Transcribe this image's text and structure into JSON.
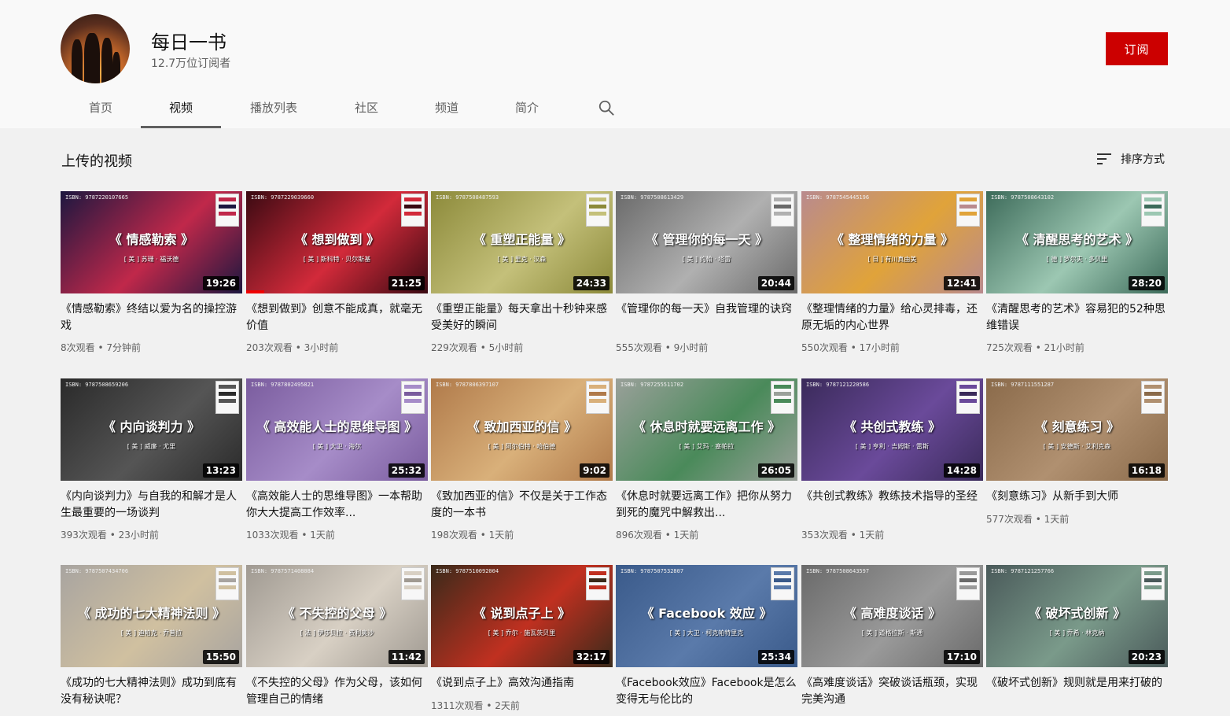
{
  "channel": {
    "name": "每日一书",
    "subscribers": "12.7万位订阅者",
    "subscribe_label": "订阅"
  },
  "tabs": [
    {
      "label": "首页",
      "active": false
    },
    {
      "label": "视频",
      "active": true
    },
    {
      "label": "播放列表",
      "active": false
    },
    {
      "label": "社区",
      "active": false
    },
    {
      "label": "频道",
      "active": false
    },
    {
      "label": "简介",
      "active": false
    }
  ],
  "search_icon": "search-icon",
  "section": {
    "title": "上传的视频",
    "sort_label": "排序方式",
    "sort_icon": "sort-icon"
  },
  "videos": [
    {
      "title": "《情感勒索》终结以爱为名的操控游戏",
      "views": "8次观看",
      "age": "7分钟前",
      "duration": "19:26",
      "thumb_title": "《 情感勒索 》",
      "thumb_author": "[ 美 ] 苏珊 · 福沃德",
      "isbn": "ISBN: 9787220107665",
      "bg": "#1c1740",
      "accent": "#c0284a"
    },
    {
      "title": "《想到做到》创意不能成真，就毫无价值",
      "views": "203次观看",
      "age": "3小时前",
      "duration": "21:25",
      "thumb_title": "《 想到做到 》",
      "thumb_author": "[ 美 ] 斯科特 · 贝尔斯基",
      "isbn": "ISBN: 9787229039660",
      "bg": "#3a0a12",
      "accent": "#d22a3a"
    },
    {
      "title": "《重塑正能量》每天拿出十秒钟来感受美好的瞬间",
      "views": "229次观看",
      "age": "5小时前",
      "duration": "24:33",
      "thumb_title": "《 重塑正能量 》",
      "thumb_author": "[ 美 ] 里克 · 汉森",
      "isbn": "ISBN: 9787508487593",
      "bg": "#8c8a3a",
      "accent": "#c4c07a"
    },
    {
      "title": "《管理你的每一天》自我管理的诀窍",
      "views": "555次观看",
      "age": "9小时前",
      "duration": "20:44",
      "thumb_title": "《 管理你的每一天 》",
      "thumb_author": "[ 美 ] 约翰 · 塔雷",
      "isbn": "ISBN: 9787508613429",
      "bg": "#6a6a6a",
      "accent": "#b0b0b0"
    },
    {
      "title": "《整理情绪的力量》给心灵排毒，还原无垢的内心世界",
      "views": "550次观看",
      "age": "17小时前",
      "duration": "12:41",
      "thumb_title": "《 整理情绪的力量 》",
      "thumb_author": "[ 日 ] 有川真由美",
      "isbn": "ISBN: 9787545445196",
      "bg": "#b98a8e",
      "accent": "#e0a33a"
    },
    {
      "title": "《清醒思考的艺术》容易犯的52种思维错误",
      "views": "725次观看",
      "age": "21小时前",
      "duration": "28:20",
      "thumb_title": "《 清醒思考的艺术 》",
      "thumb_author": "[ 德 ] 罗尔夫 · 多贝里",
      "isbn": "ISBN: 9787508643102",
      "bg": "#3d6b5a",
      "accent": "#9cc7b2"
    },
    {
      "title": "《内向谈判力》与自我的和解才是人生最重要的一场谈判",
      "views": "393次观看",
      "age": "23小时前",
      "duration": "13:23",
      "thumb_title": "《 内向谈判力 》",
      "thumb_author": "[ 美 ] 威廉 · 尤里",
      "isbn": "ISBN: 9787508659206",
      "bg": "#2a2a2a",
      "accent": "#555555"
    },
    {
      "title": "《高效能人士的思维导图》一本帮助你大大提高工作效率...",
      "views": "1033次观看",
      "age": "1天前",
      "duration": "25:32",
      "thumb_title": "《 高效能人士的思维导图 》",
      "thumb_author": "[ 美 ] 大卫 · 海尔",
      "isbn": "ISBN: 9787802495821",
      "bg": "#7a5c9e",
      "accent": "#a68cc8"
    },
    {
      "title": "《致加西亚的信》不仅是关于工作态度的一本书",
      "views": "198次观看",
      "age": "1天前",
      "duration": "9:02",
      "thumb_title": "《 致加西亚的信 》",
      "thumb_author": "[ 美 ] 阿尔伯特 · 哈伯德",
      "isbn": "ISBN: 9787806397107",
      "bg": "#b07a4a",
      "accent": "#d9b07a"
    },
    {
      "title": "《休息时就要远离工作》把你从努力到死的魔咒中解救出...",
      "views": "896次观看",
      "age": "1天前",
      "duration": "26:05",
      "thumb_title": "《 休息时就要远离工作 》",
      "thumb_author": "[ 美 ] 艾玛 · 塞帕拉",
      "isbn": "ISBN: 9787255511702",
      "bg": "#9aa09a",
      "accent": "#4a8a5a"
    },
    {
      "title": "《共创式教练》教练技术指导的圣经",
      "views": "353次观看",
      "age": "1天前",
      "duration": "14:28",
      "thumb_title": "《 共创式教练 》",
      "thumb_author": "[ 美 ] 亨利 · 吉姆斯 · 雷斯",
      "isbn": "ISBN: 9787121220586",
      "bg": "#3a2a5a",
      "accent": "#6a4a9a"
    },
    {
      "title": "《刻意练习》从新手到大师",
      "views": "577次观看",
      "age": "1天前",
      "duration": "16:18",
      "thumb_title": "《 刻意练习 》",
      "thumb_author": "[ 美 ] 安德斯 · 艾利克森",
      "isbn": "ISBN: 9787111551287",
      "bg": "#8a6a4a",
      "accent": "#b09070"
    },
    {
      "title": "《成功的七大精神法则》成功到底有没有秘诀呢？",
      "views": "",
      "age": "",
      "duration": "15:50",
      "thumb_title": "《 成功的七大精神法则 》",
      "thumb_author": "[ 美 ] 迪帕克 · 乔普拉",
      "isbn": "ISBN: 9787507434706",
      "bg": "#a8a4a0",
      "accent": "#d0c0a0"
    },
    {
      "title": "《不失控的父母》作为父母，该如何管理自己的情绪",
      "views": "",
      "age": "",
      "duration": "11:42",
      "thumb_title": "《 不失控的父母 》",
      "thumb_author": "[ 法 ] 伊莎贝拉 · 费利奥沙",
      "isbn": "ISBN: 9787571408084",
      "bg": "#a09a92",
      "accent": "#d8d0c4"
    },
    {
      "title": "《说到点子上》高效沟通指南",
      "views": "1311次观看",
      "age": "2天前",
      "duration": "32:17",
      "thumb_title": "《 说到点子上 》",
      "thumb_author": "[ 美 ] 乔尔 · 施瓦茨贝里",
      "isbn": "ISBN: 9787510092004",
      "bg": "#3a2a1a",
      "accent": "#c03020"
    },
    {
      "title": "《Facebook效应》Facebook是怎么变得无与伦比的",
      "views": "",
      "age": "",
      "duration": "25:34",
      "thumb_title": "《 Facebook 效应 》",
      "thumb_author": "[ 美 ] 大卫 · 柯克帕特里克",
      "isbn": "ISBN: 9787507532807",
      "bg": "#3a5a8a",
      "accent": "#5a7aaa"
    },
    {
      "title": "《高难度谈话》突破谈话瓶颈，实现完美沟通",
      "views": "",
      "age": "",
      "duration": "17:10",
      "thumb_title": "《 高难度谈话 》",
      "thumb_author": "[ 美 ] 道格拉斯 · 斯通",
      "isbn": "ISBN: 9787508643597",
      "bg": "#6a6a6a",
      "accent": "#9a9a9a"
    },
    {
      "title": "《破坏式创新》规则就是用来打破的",
      "views": "",
      "age": "",
      "duration": "20:23",
      "thumb_title": "《 破坏式创新 》",
      "thumb_author": "[ 美 ] 乔希 · 林克纳",
      "isbn": "ISBN: 9787121257766",
      "bg": "#4a5a5a",
      "accent": "#7a9a8a"
    }
  ]
}
